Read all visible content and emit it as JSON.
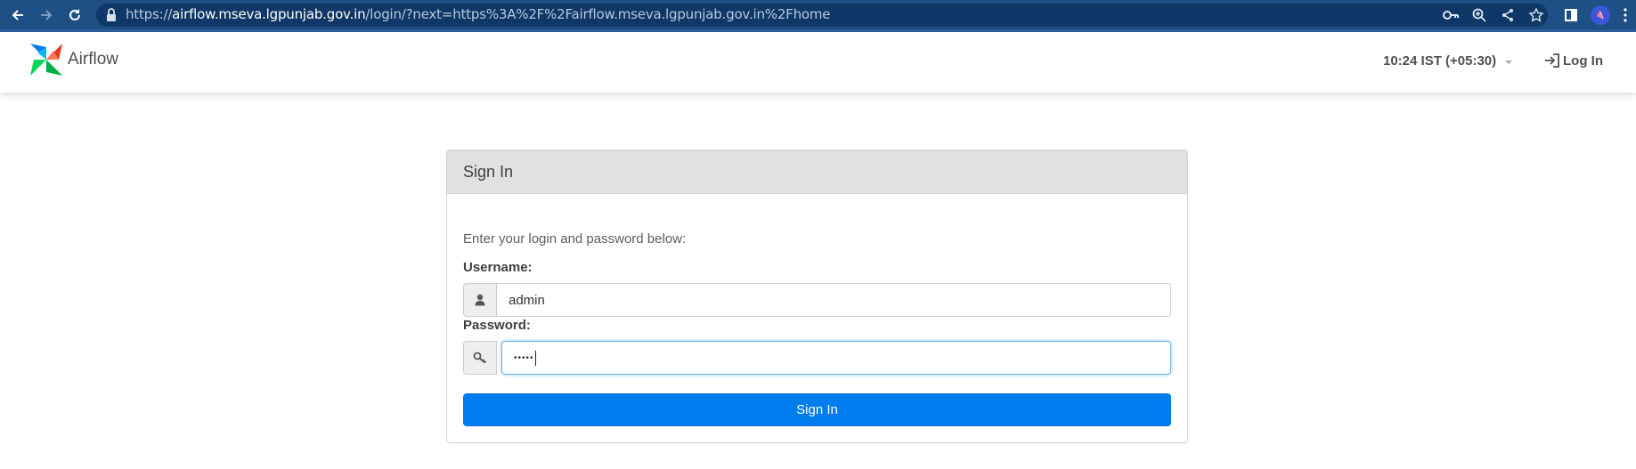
{
  "browser": {
    "url_scheme": "https://",
    "url_host": "airflow.mseva.lgpunjab.gov.in",
    "url_rest": "/login/?next=https%3A%2F%2Fairflow.mseva.lgpunjab.gov.in%2Fhome",
    "toolbar_icons": [
      "back-icon",
      "forward-icon",
      "reload-icon",
      "lock-icon",
      "key-icon",
      "zoom-icon",
      "share-icon",
      "star-icon",
      "side-panel-icon",
      "profile-icon",
      "menu-icon"
    ]
  },
  "navbar": {
    "brand": "Airflow",
    "clock": "10:24 IST (+05:30)",
    "login_label": "Log In"
  },
  "signin": {
    "title": "Sign In",
    "intro": "Enter your login and password below:",
    "username_label": "Username:",
    "username_value": "admin",
    "password_label": "Password:",
    "password_value": "•••••",
    "submit_label": "Sign In"
  },
  "colors": {
    "chrome_bar": "#1e4f85",
    "primary_button": "#017cee",
    "panel_header": "#e1e1e1",
    "focus_border": "#66afe9"
  }
}
